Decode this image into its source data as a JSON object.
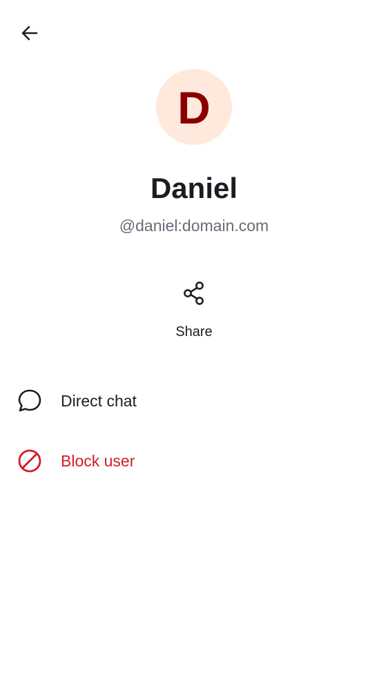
{
  "header": {
    "back_icon": "arrow-left-icon"
  },
  "profile": {
    "avatar_letter": "D",
    "avatar_bg_color": "#ffe9dd",
    "avatar_letter_color": "#8a0000",
    "display_name": "Daniel",
    "user_id": "@daniel:domain.com"
  },
  "actions": {
    "share": {
      "icon": "share-icon",
      "label": "Share"
    }
  },
  "list": {
    "items": [
      {
        "icon": "chat-bubble-icon",
        "label": "Direct chat",
        "color": "#1b1d22"
      },
      {
        "icon": "block-icon",
        "label": "Block user",
        "color": "#d51928"
      }
    ]
  }
}
